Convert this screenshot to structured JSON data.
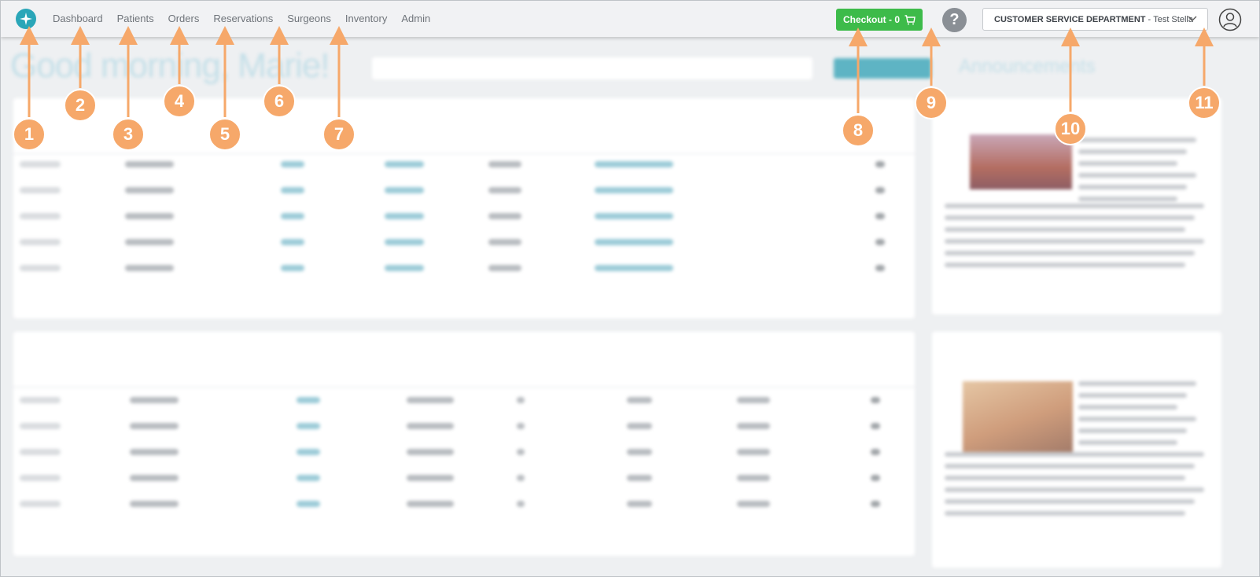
{
  "nav": {
    "logo_icon": "sparkle-logo-icon",
    "items": [
      "Dashboard",
      "Patients",
      "Orders",
      "Reservations",
      "Surgeons",
      "Inventory",
      "Admin"
    ]
  },
  "checkout": {
    "label": "Checkout - 0",
    "icon": "cart-icon",
    "color": "#3dbb4a"
  },
  "help": {
    "label": "?",
    "icon": "help-icon"
  },
  "department": {
    "name": "CUSTOMER SERVICE DEPARTMENT",
    "separator": "-",
    "user": "Test Stella",
    "icon": "chevron-down-icon"
  },
  "profile": {
    "icon": "user-profile-icon"
  },
  "callouts": [
    "1",
    "2",
    "3",
    "4",
    "5",
    "6",
    "7",
    "8",
    "9",
    "10",
    "11"
  ],
  "colors": {
    "accent": "#2aa6b8",
    "callout": "#f6a86a",
    "checkout": "#3dbb4a"
  }
}
